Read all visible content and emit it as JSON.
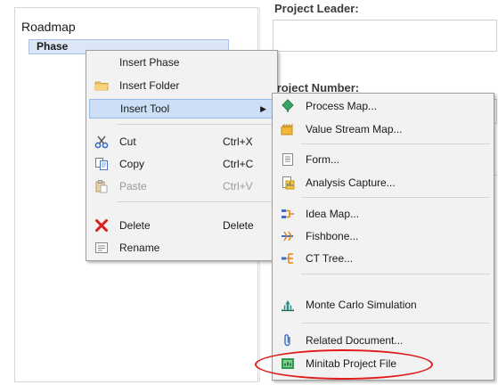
{
  "tree": {
    "root": "Roadmap",
    "phase": "Phase"
  },
  "form": {
    "project_leader_label": "Project Leader:",
    "project_number_label": "Project Number:"
  },
  "context_menu": {
    "items": [
      {
        "label": "Insert Phase",
        "shortcut": "",
        "icon": "none"
      },
      {
        "label": "Insert Folder",
        "shortcut": "",
        "icon": "folder-icon"
      },
      {
        "label": "Insert Tool",
        "shortcut": "",
        "icon": "none",
        "submenu": true,
        "highlighted": true
      },
      {
        "label": "Cut",
        "shortcut": "Ctrl+X",
        "icon": "scissors-icon"
      },
      {
        "label": "Copy",
        "shortcut": "Ctrl+C",
        "icon": "copy-icon"
      },
      {
        "label": "Paste",
        "shortcut": "Ctrl+V",
        "icon": "paste-icon",
        "disabled": true
      },
      {
        "label": "Delete",
        "shortcut": "Delete",
        "icon": "delete-x-icon"
      },
      {
        "label": "Rename",
        "shortcut": "",
        "icon": "rename-icon"
      }
    ]
  },
  "submenu": {
    "items": [
      {
        "label": "Process Map...",
        "icon": "process-map-icon"
      },
      {
        "label": "Value Stream Map...",
        "icon": "value-stream-icon"
      },
      {
        "label": "Form...",
        "icon": "form-icon"
      },
      {
        "label": "Analysis Capture...",
        "icon": "analysis-capture-icon"
      },
      {
        "label": "Idea Map...",
        "icon": "idea-map-icon"
      },
      {
        "label": "Fishbone...",
        "icon": "fishbone-icon"
      },
      {
        "label": "CT Tree...",
        "icon": "ct-tree-icon"
      },
      {
        "label": "Monte Carlo Simulation",
        "icon": "monte-carlo-icon"
      },
      {
        "label": "Related Document...",
        "icon": "paperclip-icon"
      },
      {
        "label": "Minitab Project File",
        "icon": "minitab-project-icon",
        "circled": true
      }
    ]
  },
  "annotation": {
    "circle_color": "#e11b1b"
  }
}
